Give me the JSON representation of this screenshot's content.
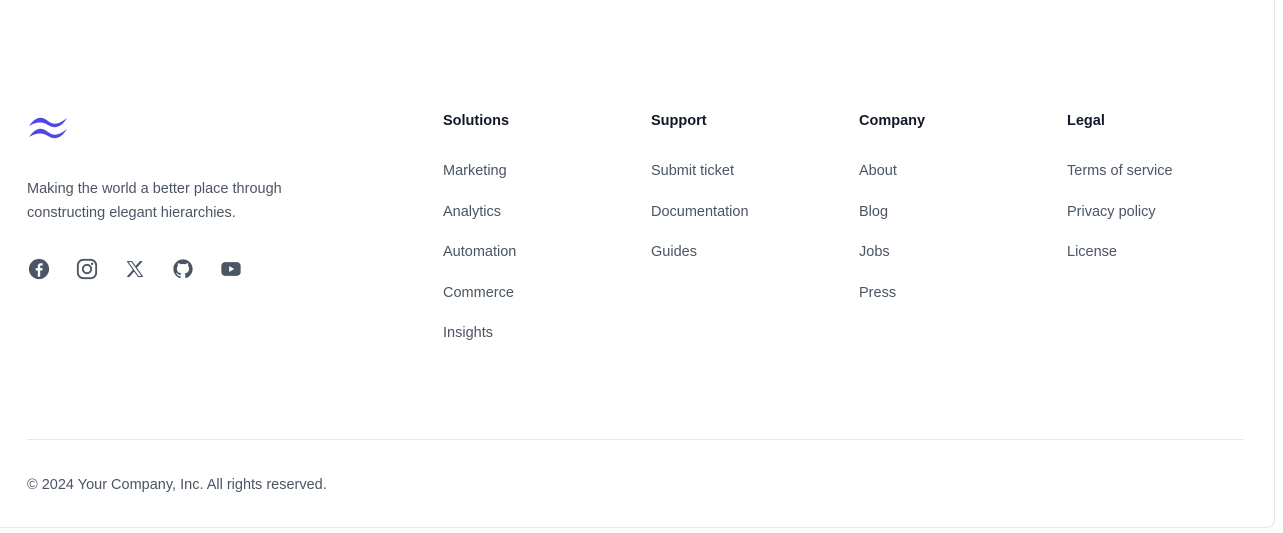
{
  "brand": {
    "logo_icon": "wave-logo-icon",
    "logo_color": "#4f46e5",
    "tagline": "Making the world a better place through constructing elegant hierarchies."
  },
  "socials": [
    {
      "name": "Facebook",
      "icon": "facebook-icon"
    },
    {
      "name": "Instagram",
      "icon": "instagram-icon"
    },
    {
      "name": "X",
      "icon": "x-icon"
    },
    {
      "name": "GitHub",
      "icon": "github-icon"
    },
    {
      "name": "YouTube",
      "icon": "youtube-icon"
    }
  ],
  "columns": {
    "solutions": {
      "title": "Solutions",
      "links": [
        "Marketing",
        "Analytics",
        "Automation",
        "Commerce",
        "Insights"
      ]
    },
    "support": {
      "title": "Support",
      "links": [
        "Submit ticket",
        "Documentation",
        "Guides"
      ]
    },
    "company": {
      "title": "Company",
      "links": [
        "About",
        "Blog",
        "Jobs",
        "Press"
      ]
    },
    "legal": {
      "title": "Legal",
      "links": [
        "Terms of service",
        "Privacy policy",
        "License"
      ]
    }
  },
  "footer": {
    "copyright": "© 2024 Your Company, Inc. All rights reserved."
  },
  "colors": {
    "text_muted": "#4b5563",
    "heading": "#111827",
    "icon": "#4b5563",
    "divider": "#e5e7eb"
  }
}
